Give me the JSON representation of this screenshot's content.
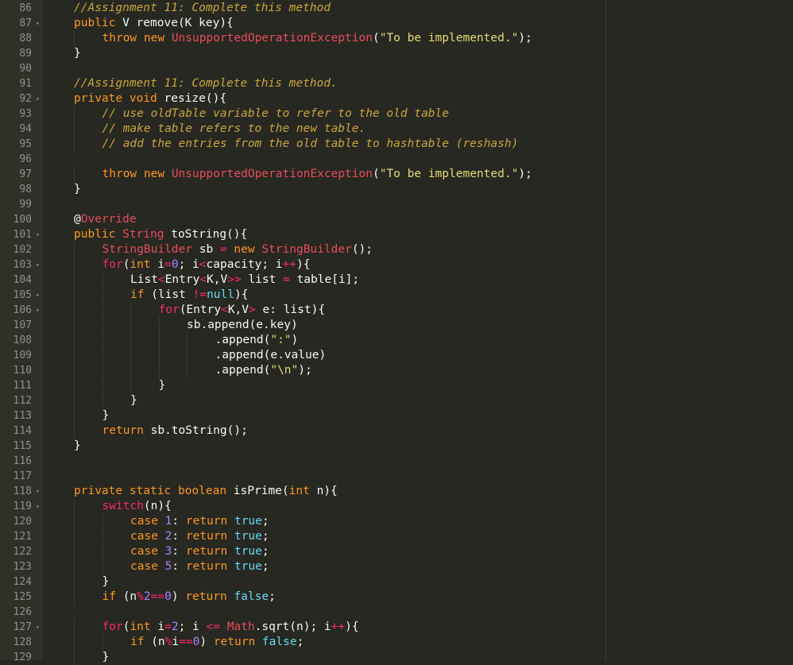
{
  "editor": {
    "theme_colors": {
      "background": "#272822",
      "gutter": "#2f3129",
      "line_number": "#8f908a",
      "keyword": "#f92672",
      "type_orange": "#fd971f",
      "string": "#e6db74",
      "comment": "#c9a53c",
      "number": "#ae81ff",
      "boolean": "#66d9ef"
    },
    "lines": [
      {
        "n": "86",
        "fold": false,
        "indent": 1,
        "tokens": [
          [
            "//Assignment 11: Complete this method",
            "cmt"
          ]
        ]
      },
      {
        "n": "87",
        "fold": true,
        "indent": 1,
        "tokens": [
          [
            "public ",
            "orange"
          ],
          [
            "V remove(K key){",
            "plain"
          ]
        ]
      },
      {
        "n": "88",
        "fold": false,
        "indent": 2,
        "tokens": [
          [
            "throw ",
            "orange"
          ],
          [
            "new ",
            "orange"
          ],
          [
            "UnsupportedOperationException",
            "err"
          ],
          [
            "(",
            "plain"
          ],
          [
            "\"To be implemented.\"",
            "str"
          ],
          [
            ");",
            "plain"
          ]
        ]
      },
      {
        "n": "89",
        "fold": false,
        "indent": 1,
        "tokens": [
          [
            "}",
            "plain"
          ]
        ]
      },
      {
        "n": "90",
        "fold": false,
        "indent": 0,
        "tokens": []
      },
      {
        "n": "91",
        "fold": false,
        "indent": 1,
        "tokens": [
          [
            "//Assignment 11: Complete this method.",
            "cmt"
          ]
        ]
      },
      {
        "n": "92",
        "fold": true,
        "indent": 1,
        "tokens": [
          [
            "private ",
            "orange"
          ],
          [
            "void ",
            "orange"
          ],
          [
            "resize(){",
            "plain"
          ]
        ]
      },
      {
        "n": "93",
        "fold": false,
        "indent": 2,
        "tokens": [
          [
            "// use oldTable variable to refer to the old table",
            "cmt"
          ]
        ]
      },
      {
        "n": "94",
        "fold": false,
        "indent": 2,
        "tokens": [
          [
            "// make table refers to the new table.",
            "cmt"
          ]
        ]
      },
      {
        "n": "95",
        "fold": false,
        "indent": 2,
        "tokens": [
          [
            "// add the entries from the old table to hashtable (reshash)",
            "cmt"
          ]
        ]
      },
      {
        "n": "96",
        "fold": false,
        "indent": 0,
        "tokens": []
      },
      {
        "n": "97",
        "fold": false,
        "indent": 2,
        "tokens": [
          [
            "throw ",
            "orange"
          ],
          [
            "new ",
            "orange"
          ],
          [
            "UnsupportedOperationException",
            "err"
          ],
          [
            "(",
            "plain"
          ],
          [
            "\"To be implemented.\"",
            "str"
          ],
          [
            ");",
            "plain"
          ]
        ]
      },
      {
        "n": "98",
        "fold": false,
        "indent": 1,
        "tokens": [
          [
            "}",
            "plain"
          ]
        ]
      },
      {
        "n": "99",
        "fold": false,
        "indent": 0,
        "tokens": []
      },
      {
        "n": "100",
        "fold": false,
        "indent": 1,
        "tokens": [
          [
            "@",
            "ann"
          ],
          [
            "Override",
            "err"
          ]
        ]
      },
      {
        "n": "101",
        "fold": true,
        "indent": 1,
        "tokens": [
          [
            "public ",
            "orange"
          ],
          [
            "String ",
            "err"
          ],
          [
            "toString(){",
            "plain"
          ]
        ]
      },
      {
        "n": "102",
        "fold": false,
        "indent": 2,
        "tokens": [
          [
            "StringBuilder ",
            "err"
          ],
          [
            "sb ",
            "plain"
          ],
          [
            "= ",
            "kw"
          ],
          [
            "new ",
            "orange"
          ],
          [
            "StringBuilder",
            "err"
          ],
          [
            "();",
            "plain"
          ]
        ]
      },
      {
        "n": "103",
        "fold": true,
        "indent": 2,
        "tokens": [
          [
            "for",
            "kw"
          ],
          [
            "(",
            "plain"
          ],
          [
            "int ",
            "orange"
          ],
          [
            "i",
            "plain"
          ],
          [
            "=",
            "kw"
          ],
          [
            "0",
            "num"
          ],
          [
            "; i",
            "plain"
          ],
          [
            "<",
            "kw"
          ],
          [
            "capacity; i",
            "plain"
          ],
          [
            "++",
            "kw"
          ],
          [
            "){",
            "plain"
          ]
        ]
      },
      {
        "n": "104",
        "fold": false,
        "indent": 3,
        "tokens": [
          [
            "List",
            "plain"
          ],
          [
            "<",
            "kw"
          ],
          [
            "Entry",
            "plain"
          ],
          [
            "<",
            "kw"
          ],
          [
            "K,V",
            "plain"
          ],
          [
            ">> ",
            "kw"
          ],
          [
            "list ",
            "plain"
          ],
          [
            "= ",
            "kw"
          ],
          [
            "table[i];",
            "plain"
          ]
        ]
      },
      {
        "n": "105",
        "fold": true,
        "indent": 3,
        "tokens": [
          [
            "if ",
            "orange"
          ],
          [
            "(list ",
            "plain"
          ],
          [
            "!=",
            "kw"
          ],
          [
            "null",
            "bool"
          ],
          [
            "){",
            "plain"
          ]
        ]
      },
      {
        "n": "106",
        "fold": true,
        "indent": 4,
        "tokens": [
          [
            "for",
            "kw"
          ],
          [
            "(Entry",
            "plain"
          ],
          [
            "<",
            "kw"
          ],
          [
            "K,V",
            "plain"
          ],
          [
            "> ",
            "kw"
          ],
          [
            "e: list){",
            "plain"
          ]
        ]
      },
      {
        "n": "107",
        "fold": false,
        "indent": 5,
        "tokens": [
          [
            "sb.append(e.key)",
            "plain"
          ]
        ]
      },
      {
        "n": "108",
        "fold": false,
        "indent": 6,
        "tokens": [
          [
            ".append(",
            "plain"
          ],
          [
            "\":\"",
            "str"
          ],
          [
            ")",
            "plain"
          ]
        ]
      },
      {
        "n": "109",
        "fold": false,
        "indent": 6,
        "tokens": [
          [
            ".append(e.value)",
            "plain"
          ]
        ]
      },
      {
        "n": "110",
        "fold": false,
        "indent": 6,
        "tokens": [
          [
            ".append(",
            "plain"
          ],
          [
            "\"\\n\"",
            "str"
          ],
          [
            ");",
            "plain"
          ]
        ]
      },
      {
        "n": "111",
        "fold": false,
        "indent": 4,
        "tokens": [
          [
            "}",
            "plain"
          ]
        ]
      },
      {
        "n": "112",
        "fold": false,
        "indent": 3,
        "tokens": [
          [
            "}",
            "plain"
          ]
        ]
      },
      {
        "n": "113",
        "fold": false,
        "indent": 2,
        "tokens": [
          [
            "}",
            "plain"
          ]
        ]
      },
      {
        "n": "114",
        "fold": false,
        "indent": 2,
        "tokens": [
          [
            "return ",
            "orange"
          ],
          [
            "sb.toString();",
            "plain"
          ]
        ]
      },
      {
        "n": "115",
        "fold": false,
        "indent": 1,
        "tokens": [
          [
            "}",
            "plain"
          ]
        ]
      },
      {
        "n": "116",
        "fold": false,
        "indent": 0,
        "tokens": []
      },
      {
        "n": "117",
        "fold": false,
        "indent": 0,
        "tokens": []
      },
      {
        "n": "118",
        "fold": true,
        "indent": 1,
        "tokens": [
          [
            "private ",
            "orange"
          ],
          [
            "static ",
            "orange"
          ],
          [
            "boolean ",
            "orange"
          ],
          [
            "isPrime(",
            "plain"
          ],
          [
            "int ",
            "orange"
          ],
          [
            "n){",
            "plain"
          ]
        ]
      },
      {
        "n": "119",
        "fold": true,
        "indent": 2,
        "tokens": [
          [
            "switch",
            "kw"
          ],
          [
            "(n){",
            "plain"
          ]
        ]
      },
      {
        "n": "120",
        "fold": false,
        "indent": 3,
        "tokens": [
          [
            "case ",
            "orange"
          ],
          [
            "1",
            "num"
          ],
          [
            ": ",
            "plain"
          ],
          [
            "return ",
            "orange"
          ],
          [
            "true",
            "bool"
          ],
          [
            ";",
            "plain"
          ]
        ]
      },
      {
        "n": "121",
        "fold": false,
        "indent": 3,
        "tokens": [
          [
            "case ",
            "orange"
          ],
          [
            "2",
            "num"
          ],
          [
            ": ",
            "plain"
          ],
          [
            "return ",
            "orange"
          ],
          [
            "true",
            "bool"
          ],
          [
            ";",
            "plain"
          ]
        ]
      },
      {
        "n": "122",
        "fold": false,
        "indent": 3,
        "tokens": [
          [
            "case ",
            "orange"
          ],
          [
            "3",
            "num"
          ],
          [
            ": ",
            "plain"
          ],
          [
            "return ",
            "orange"
          ],
          [
            "true",
            "bool"
          ],
          [
            ";",
            "plain"
          ]
        ]
      },
      {
        "n": "123",
        "fold": false,
        "indent": 3,
        "tokens": [
          [
            "case ",
            "orange"
          ],
          [
            "5",
            "num"
          ],
          [
            ": ",
            "plain"
          ],
          [
            "return ",
            "orange"
          ],
          [
            "true",
            "bool"
          ],
          [
            ";",
            "plain"
          ]
        ]
      },
      {
        "n": "124",
        "fold": false,
        "indent": 2,
        "tokens": [
          [
            "}",
            "plain"
          ]
        ]
      },
      {
        "n": "125",
        "fold": false,
        "indent": 2,
        "tokens": [
          [
            "if ",
            "orange"
          ],
          [
            "(n",
            "plain"
          ],
          [
            "%",
            "kw"
          ],
          [
            "2",
            "num"
          ],
          [
            "==",
            "kw"
          ],
          [
            "0",
            "num"
          ],
          [
            ") ",
            "plain"
          ],
          [
            "return ",
            "orange"
          ],
          [
            "false",
            "bool"
          ],
          [
            ";",
            "plain"
          ]
        ]
      },
      {
        "n": "126",
        "fold": false,
        "indent": 0,
        "tokens": []
      },
      {
        "n": "127",
        "fold": true,
        "indent": 2,
        "tokens": [
          [
            "for",
            "kw"
          ],
          [
            "(",
            "plain"
          ],
          [
            "int ",
            "orange"
          ],
          [
            "i",
            "plain"
          ],
          [
            "=",
            "kw"
          ],
          [
            "2",
            "num"
          ],
          [
            "; i ",
            "plain"
          ],
          [
            "<= ",
            "kw"
          ],
          [
            "Math",
            "err"
          ],
          [
            ".sqrt(n); i",
            "plain"
          ],
          [
            "++",
            "kw"
          ],
          [
            "){",
            "plain"
          ]
        ]
      },
      {
        "n": "128",
        "fold": false,
        "indent": 3,
        "tokens": [
          [
            "if ",
            "orange"
          ],
          [
            "(n",
            "plain"
          ],
          [
            "%",
            "kw"
          ],
          [
            "i",
            "plain"
          ],
          [
            "==",
            "kw"
          ],
          [
            "0",
            "num"
          ],
          [
            ") ",
            "plain"
          ],
          [
            "return ",
            "orange"
          ],
          [
            "false",
            "bool"
          ],
          [
            ";",
            "plain"
          ]
        ]
      },
      {
        "n": "129",
        "fold": false,
        "indent": 2,
        "tokens": [
          [
            "}",
            "plain"
          ]
        ]
      }
    ]
  }
}
